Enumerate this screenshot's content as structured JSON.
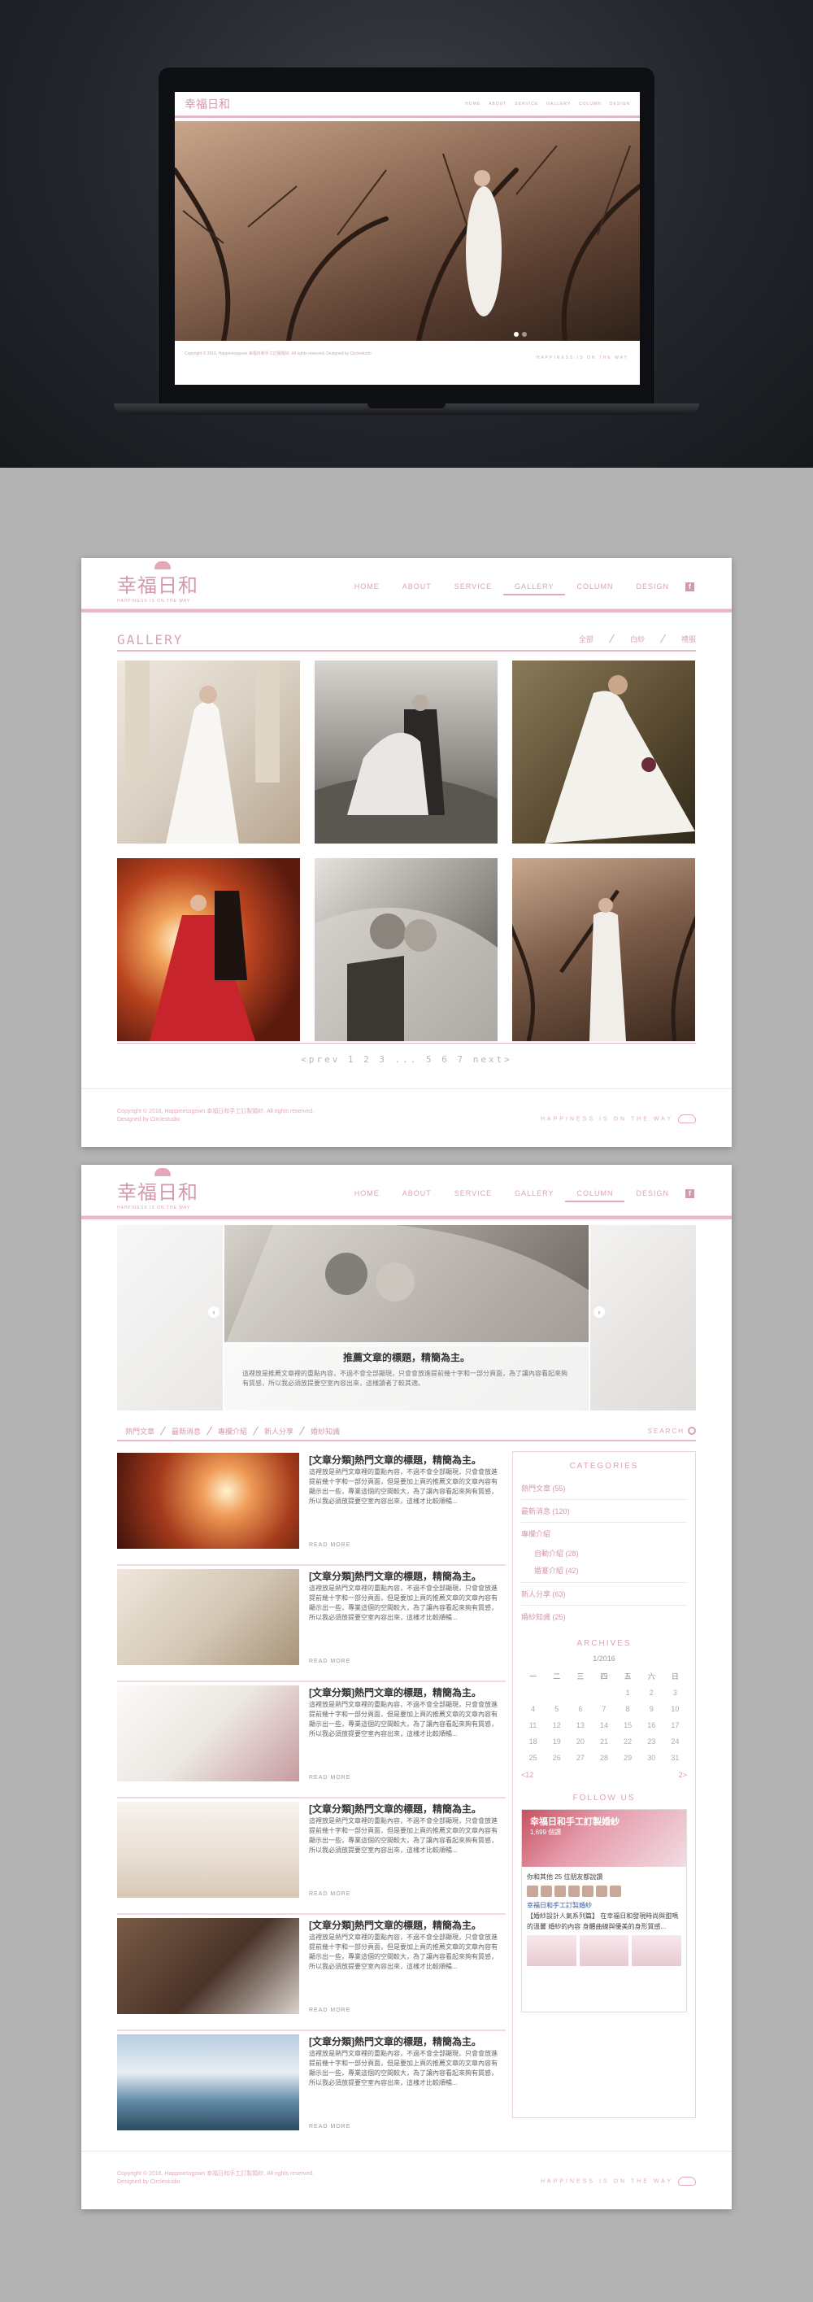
{
  "brand": {
    "logo_text": "幸福日和",
    "logo_sub": "HAPPINESS IS ON THE WAY"
  },
  "nav": {
    "items": [
      "HOME",
      "ABOUT",
      "SERVICE",
      "GALLERY",
      "COLUMN",
      "DESIGN"
    ],
    "facebook": "f"
  },
  "hero": {
    "footer_text": "Copyright © 2016, Happinessgown 幸福日和手工訂製婚紗. All rights reserved. Designed by Circlestudio",
    "tagline": "HAPPINESS IS ON THE WAY"
  },
  "gallery_page": {
    "active_nav": "GALLERY",
    "title": "GALLERY",
    "filters": [
      "全部",
      "白紗",
      "禮服"
    ],
    "pager": "<prev  1 2 3  ...  5 6 7  next>"
  },
  "column_page": {
    "active_nav": "COLUMN",
    "slider": {
      "title": "推薦文章的標題，精簡為主。",
      "excerpt": "這裡放是推薦文章裡的重點內容，不過不會全部顯現，只會會放進提前幾十字和一部分頁面，為了讓內容看起來夠有質感，所以我必須放提要空室內容出來，這樣讀者了較其適。"
    },
    "categories": [
      "熱門文章",
      "最新消息",
      "專欄介紹",
      "新人分享",
      "婚紗知識"
    ],
    "search_label": "SEARCH",
    "articles": [
      {
        "title": "[文章分類]熱門文章的標題，精簡為主。",
        "excerpt": "這裡放是熱門文章裡的重點內容，不過不會全部顯現，只會會放進提前幾十字和一部分頁面，但是要加上頁的推薦文章的文章內容有顯示出一些，專業這個的空間較大，為了讓內容看起來夠有質感，所以我必須放提要空室內容出來，這樣才比較順暢...",
        "more": "READ MORE"
      },
      {
        "title": "[文章分類]熱門文章的標題，精簡為主。",
        "excerpt": "這裡放是熱門文章裡的重點內容，不過不會全部顯現，只會會放進提前幾十字和一部分頁面，但是要加上頁的推薦文章的文章內容有顯示出一些，專業這個的空間較大，為了讓內容看起來夠有質感，所以我必須放提要空室內容出來，這樣才比較順暢...",
        "more": "READ MORE"
      },
      {
        "title": "[文章分類]熱門文章的標題，精簡為主。",
        "excerpt": "這裡放是熱門文章裡的重點內容，不過不會全部顯現，只會會放進提前幾十字和一部分頁面，但是要加上頁的推薦文章的文章內容有顯示出一些，專業這個的空間較大，為了讓內容看起來夠有質感，所以我必須放提要空室內容出來，這樣才比較順暢...",
        "more": "READ MORE"
      },
      {
        "title": "[文章分類]熱門文章的標題，精簡為主。",
        "excerpt": "這裡放是熱門文章裡的重點內容，不過不會全部顯現，只會會放進提前幾十字和一部分頁面，但是要加上頁的推薦文章的文章內容有顯示出一些，專業這個的空間較大，為了讓內容看起來夠有質感，所以我必須放提要空室內容出來，這樣才比較順暢...",
        "more": "READ MORE"
      },
      {
        "title": "[文章分類]熱門文章的標題，精簡為主。",
        "excerpt": "這裡放是熱門文章裡的重點內容，不過不會全部顯現，只會會放進提前幾十字和一部分頁面，但是要加上頁的推薦文章的文章內容有顯示出一些，專業這個的空間較大，為了讓內容看起來夠有質感，所以我必須放提要空室內容出來，這樣才比較順暢...",
        "more": "READ MORE"
      },
      {
        "title": "[文章分類]熱門文章的標題，精簡為主。",
        "excerpt": "這裡放是熱門文章裡的重點內容，不過不會全部顯現，只會會放進提前幾十字和一部分頁面，但是要加上頁的推薦文章的文章內容有顯示出一些，專業這個的空間較大，為了讓內容看起來夠有質感，所以我必須放提要空室內容出來，這樣才比較順暢...",
        "more": "READ MORE"
      }
    ],
    "sidebar": {
      "categories_heading": "CATEGORIES",
      "category_items": [
        "熱門文章 (55)",
        "最新消息 (120)",
        "專欄介紹",
        "自動介紹 (28)",
        "婚宴介紹 (42)",
        "新人分享 (63)",
        "婚紗知識 (25)"
      ],
      "archives_heading": "ARCHIVES",
      "month": "1/2016",
      "weekdays": [
        "一",
        "二",
        "三",
        "四",
        "五",
        "六",
        "日"
      ],
      "weeks": [
        [
          "",
          "",
          "",
          "",
          "1",
          "2",
          "3"
        ],
        [
          "4",
          "5",
          "6",
          "7",
          "8",
          "9",
          "10"
        ],
        [
          "11",
          "12",
          "13",
          "14",
          "15",
          "16",
          "17"
        ],
        [
          "18",
          "19",
          "20",
          "21",
          "22",
          "23",
          "24"
        ],
        [
          "25",
          "26",
          "27",
          "28",
          "29",
          "30",
          "31"
        ]
      ],
      "prev": "<12",
      "next": "2>",
      "follow_heading": "FOLLOW US",
      "fb_page_name": "幸福日和手工訂製婚紗",
      "fb_likes": "1,699 個讚",
      "fb_friends": "你和其他 25 位朋友都說讚",
      "fb_post_author": "幸福日和手工訂製婚紗",
      "fb_post_text": "【婚紗設計人氣系列篇】 在幸福日和發現時尚與甜嗎的溫馨 婚紗的內容 身體曲線與優美的身形質感..."
    }
  },
  "footer": {
    "copyright": "Copyright © 2016, Happinessgown 幸福日和手工訂製婚紗. All rights reserved.",
    "designed_by": "Designed by Circlestudio",
    "tagline": "HAPPINESS IS ON THE WAY"
  }
}
